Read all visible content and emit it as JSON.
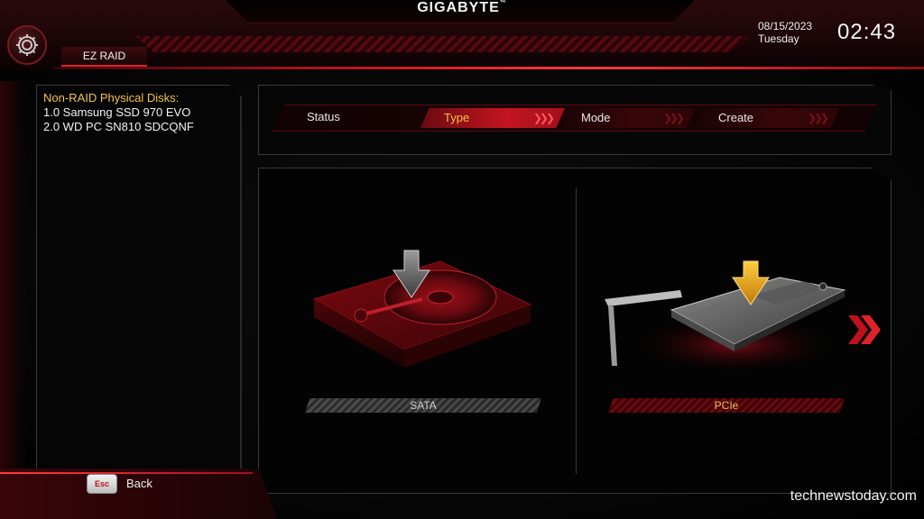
{
  "header": {
    "brand": "GIGABYTE",
    "brand_tm": "™",
    "tab_label": "EZ RAID",
    "date": "08/15/2023",
    "weekday": "Tuesday",
    "time": "02:43"
  },
  "disks": {
    "title": "Non-RAID Physical Disks:",
    "items": [
      {
        "label": "1.0  Samsung SSD 970 EVO"
      },
      {
        "label": "2.0  WD PC SN810 SDCQNF"
      }
    ]
  },
  "steps": [
    {
      "label": "Status",
      "state": "done"
    },
    {
      "label": "Type",
      "state": "active"
    },
    {
      "label": "Mode",
      "state": "pending"
    },
    {
      "label": "Create",
      "state": "pending"
    }
  ],
  "options": [
    {
      "label": "SATA",
      "selected": false
    },
    {
      "label": "PCIe",
      "selected": true
    }
  ],
  "footer": {
    "esc_key": "Esc",
    "back_label": "Back",
    "watermark": "technewstoday.com"
  },
  "colors": {
    "accent_red": "#d31a25",
    "highlight_yellow": "#f2c24a",
    "panel_border": "#3a3a3a"
  },
  "icons": {
    "settings": "gear-icon",
    "sata_drive": "hdd-icon",
    "pcie_drive": "pcie-card-icon",
    "download_arrow": "down-arrow-icon",
    "next": "chevron-right-icon"
  }
}
